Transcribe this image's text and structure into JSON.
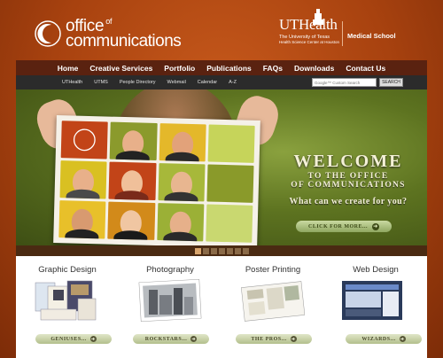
{
  "header": {
    "logo_office": "office",
    "logo_of": "of",
    "logo_comm": "communications",
    "uth_name": "UTHealth",
    "uth_sub1": "The University of Texas",
    "uth_sub2": "Health Science Center at Houston",
    "school": "Medical School"
  },
  "nav": [
    "Home",
    "Creative Services",
    "Portfolio",
    "Publications",
    "FAQs",
    "Downloads",
    "Contact Us"
  ],
  "subnav": {
    "links": [
      "UTHealth",
      "UTMS",
      "People Directory",
      "Webmail",
      "Calendar",
      "A-Z"
    ],
    "search_placeholder": "Google™ Custom Search",
    "search_button": "SEARCH"
  },
  "hero": {
    "welcome": "WELCOME",
    "line2": "TO THE OFFICE",
    "line3": "OF COMMUNICATIONS",
    "tagline": "What can we create for you?",
    "cta": "CLICK FOR MORE...",
    "cta_arrow": "➜"
  },
  "slider": {
    "count": 7,
    "active": 0
  },
  "services": [
    {
      "title": "Graphic Design",
      "button": "GENIUSES..."
    },
    {
      "title": "Photography",
      "button": "ROCKSTARS..."
    },
    {
      "title": "Poster Printing",
      "button": "THE PROS..."
    },
    {
      "title": "Web Design",
      "button": "WIZARDS..."
    }
  ],
  "colors": {
    "nav_bg": "#5a2210",
    "hero_green": "#5d7320",
    "accent_orange": "#a8420f"
  }
}
